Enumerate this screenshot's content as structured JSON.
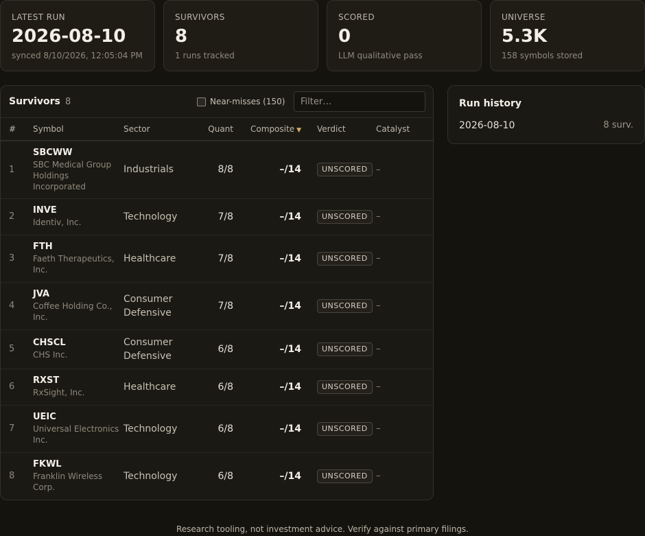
{
  "stats": [
    {
      "label": "LATEST RUN",
      "value": "2026-08-10",
      "sub": "synced 8/10/2026, 12:05:04 PM"
    },
    {
      "label": "SURVIVORS",
      "value": "8",
      "sub": "1 runs tracked"
    },
    {
      "label": "SCORED",
      "value": "0",
      "sub": "LLM qualitative pass"
    },
    {
      "label": "UNIVERSE",
      "value": "5.3K",
      "sub": "158 symbols stored"
    }
  ],
  "survivors": {
    "title": "Survivors",
    "count": "8",
    "near_misses_label": "Near-misses (150)",
    "filter_placeholder": "Filter…",
    "columns": {
      "idx": "#",
      "symbol": "Symbol",
      "sector": "Sector",
      "quant": "Quant",
      "composite": "Composite",
      "verdict": "Verdict",
      "catalyst": "Catalyst"
    },
    "sort_indicator": "▼",
    "rows": [
      {
        "idx": "1",
        "symbol": "SBCWW",
        "name": "SBC Medical Group Holdings Incorporated",
        "sector": "Industrials",
        "quant": "8/8",
        "composite": "–/14",
        "verdict": "UNSCORED",
        "catalyst": "–"
      },
      {
        "idx": "2",
        "symbol": "INVE",
        "name": "Identiv, Inc.",
        "sector": "Technology",
        "quant": "7/8",
        "composite": "–/14",
        "verdict": "UNSCORED",
        "catalyst": "–"
      },
      {
        "idx": "3",
        "symbol": "FTH",
        "name": "Faeth Therapeutics, Inc.",
        "sector": "Healthcare",
        "quant": "7/8",
        "composite": "–/14",
        "verdict": "UNSCORED",
        "catalyst": "–"
      },
      {
        "idx": "4",
        "symbol": "JVA",
        "name": "Coffee Holding Co., Inc.",
        "sector": "Consumer Defensive",
        "quant": "7/8",
        "composite": "–/14",
        "verdict": "UNSCORED",
        "catalyst": "–"
      },
      {
        "idx": "5",
        "symbol": "CHSCL",
        "name": "CHS Inc.",
        "sector": "Consumer Defensive",
        "quant": "6/8",
        "composite": "–/14",
        "verdict": "UNSCORED",
        "catalyst": "–"
      },
      {
        "idx": "6",
        "symbol": "RXST",
        "name": "RxSight, Inc.",
        "sector": "Healthcare",
        "quant": "6/8",
        "composite": "–/14",
        "verdict": "UNSCORED",
        "catalyst": "–"
      },
      {
        "idx": "7",
        "symbol": "UEIC",
        "name": "Universal Electronics Inc.",
        "sector": "Technology",
        "quant": "6/8",
        "composite": "–/14",
        "verdict": "UNSCORED",
        "catalyst": "–"
      },
      {
        "idx": "8",
        "symbol": "FKWL",
        "name": "Franklin Wireless Corp.",
        "sector": "Technology",
        "quant": "6/8",
        "composite": "–/14",
        "verdict": "UNSCORED",
        "catalyst": "–"
      }
    ]
  },
  "history": {
    "title": "Run history",
    "runs": [
      {
        "date": "2026-08-10",
        "count": "8 surv."
      }
    ]
  },
  "footer": "Research tooling, not investment advice. Verify against primary filings."
}
